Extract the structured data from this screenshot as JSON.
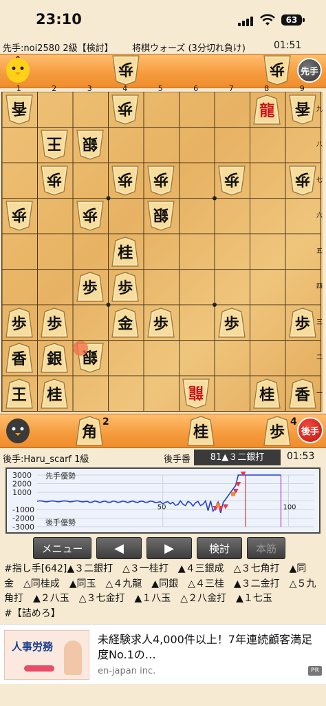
{
  "status_bar": {
    "time": "23:10",
    "battery": "63"
  },
  "game": {
    "sente_label": "先手:noi2580 2級【検討】",
    "title": "将棋ウォーズ (3分切れ負け)",
    "sente_clock": "01:51",
    "sente_badge": "先手",
    "gote_label": "後手:Haru_scarf 1級",
    "turn_label": "後手番",
    "current_move": "81▲３二銀打",
    "gote_clock": "01:53",
    "gote_badge": "後手"
  },
  "board": {
    "file_labels": [
      "1",
      "2",
      "3",
      "4",
      "5",
      "6",
      "7",
      "8",
      "9"
    ],
    "rank_labels": [
      "九",
      "八",
      "七",
      "六",
      "五",
      "四",
      "三",
      "二",
      "一"
    ],
    "pieces": [
      {
        "f": 0,
        "r": 0,
        "ch": "香",
        "up": false
      },
      {
        "f": 3,
        "r": 0,
        "ch": "歩",
        "up": false
      },
      {
        "f": 7,
        "r": 0,
        "ch": "龍",
        "up": true,
        "red": true
      },
      {
        "f": 8,
        "r": 0,
        "ch": "香",
        "up": false
      },
      {
        "f": 1,
        "r": 1,
        "ch": "王",
        "up": false
      },
      {
        "f": 2,
        "r": 1,
        "ch": "銀",
        "up": false
      },
      {
        "f": 1,
        "r": 2,
        "ch": "歩",
        "up": false
      },
      {
        "f": 3,
        "r": 2,
        "ch": "歩",
        "up": false
      },
      {
        "f": 4,
        "r": 2,
        "ch": "歩",
        "up": false
      },
      {
        "f": 6,
        "r": 2,
        "ch": "歩",
        "up": false
      },
      {
        "f": 8,
        "r": 2,
        "ch": "歩",
        "up": false
      },
      {
        "f": 0,
        "r": 3,
        "ch": "歩",
        "up": false
      },
      {
        "f": 2,
        "r": 3,
        "ch": "歩",
        "up": false
      },
      {
        "f": 4,
        "r": 3,
        "ch": "銀",
        "up": false
      },
      {
        "f": 3,
        "r": 4,
        "ch": "桂",
        "up": true
      },
      {
        "f": 2,
        "r": 5,
        "ch": "歩",
        "up": true
      },
      {
        "f": 3,
        "r": 5,
        "ch": "歩",
        "up": true
      },
      {
        "f": 0,
        "r": 6,
        "ch": "歩",
        "up": true
      },
      {
        "f": 1,
        "r": 6,
        "ch": "歩",
        "up": true
      },
      {
        "f": 3,
        "r": 6,
        "ch": "金",
        "up": true
      },
      {
        "f": 4,
        "r": 6,
        "ch": "歩",
        "up": true
      },
      {
        "f": 6,
        "r": 6,
        "ch": "歩",
        "up": true
      },
      {
        "f": 8,
        "r": 6,
        "ch": "歩",
        "up": true
      },
      {
        "f": 0,
        "r": 7,
        "ch": "香",
        "up": true
      },
      {
        "f": 1,
        "r": 7,
        "ch": "銀",
        "up": true
      },
      {
        "f": 2,
        "r": 7,
        "ch": "銀",
        "up": false
      },
      {
        "f": 0,
        "r": 8,
        "ch": "王",
        "up": true
      },
      {
        "f": 1,
        "r": 8,
        "ch": "桂",
        "up": true
      },
      {
        "f": 5,
        "r": 8,
        "ch": "龍",
        "up": false,
        "red": true
      },
      {
        "f": 7,
        "r": 8,
        "ch": "桂",
        "up": true
      },
      {
        "f": 8,
        "r": 8,
        "ch": "香",
        "up": true
      }
    ],
    "sente_hand": [
      {
        "ch": "歩"
      },
      {
        "ch": "歩"
      }
    ],
    "gote_hand": [
      {
        "ch": "角",
        "count": "2"
      },
      {
        "ch": "桂"
      },
      {
        "ch": "歩",
        "count": "4"
      }
    ]
  },
  "chart": {
    "y_labels": [
      "3000",
      "2000",
      "1000",
      "-1000",
      "-2000",
      "-3000"
    ],
    "x_labels": [
      "50",
      "100"
    ],
    "sente_adv": "先手優勢",
    "gote_adv": "後手優勢",
    "ylim": [
      -3000,
      3000
    ],
    "xlim": [
      0,
      110
    ]
  },
  "buttons": {
    "menu": "メニュー",
    "back": "◀",
    "forward": "▶",
    "analyze": "検討",
    "mainline": "本筋"
  },
  "kifu": {
    "line1": "#指し手[642]▲３二銀打　△３一桂打　▲４三銀成　△３七角打　▲同",
    "line2": "金　△同桂成　▲同玉　△４九龍　▲同銀　△４三桂　▲３二金打　△５九",
    "line3": "角打　▲２八玉　△３七金打　▲１八玉　△２八金打　▲１七玉",
    "line4": "#【詰めろ】"
  },
  "ad": {
    "banner_title": "人事労務",
    "text": "未経験求人4,000件以上！7年連続顧客満足度No.1の…",
    "advertiser": "en-japan inc.",
    "pr": "PR"
  }
}
